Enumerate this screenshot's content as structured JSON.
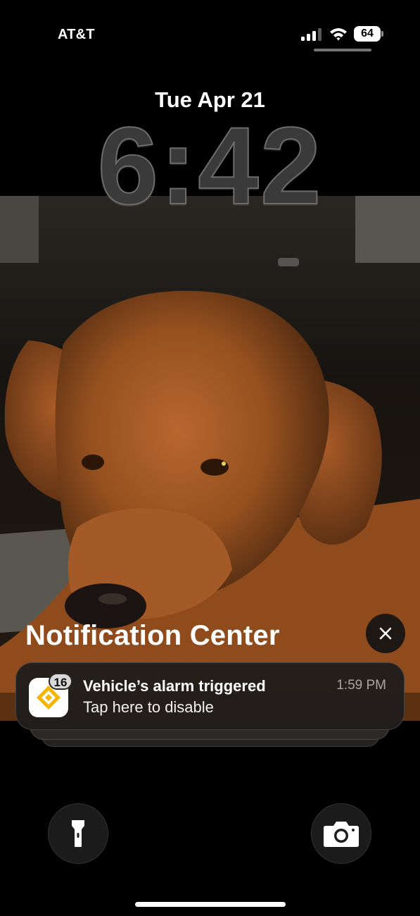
{
  "status_bar": {
    "carrier": "AT&T",
    "battery_level": "64",
    "signal_bars_active": 3
  },
  "lock_screen": {
    "date": "Tue Apr 21",
    "time": "6:42"
  },
  "notification_center": {
    "title": "Notification Center",
    "notification": {
      "badge_count": "16",
      "title": "Vehicle’s alarm triggered",
      "body": "Tap here to disable",
      "time": "1:59 PM",
      "app_icon": "diamond-logo-icon",
      "accent_color": "#f5b400"
    }
  },
  "controls": {
    "left_icon": "flashlight-icon",
    "right_icon": "camera-icon"
  }
}
